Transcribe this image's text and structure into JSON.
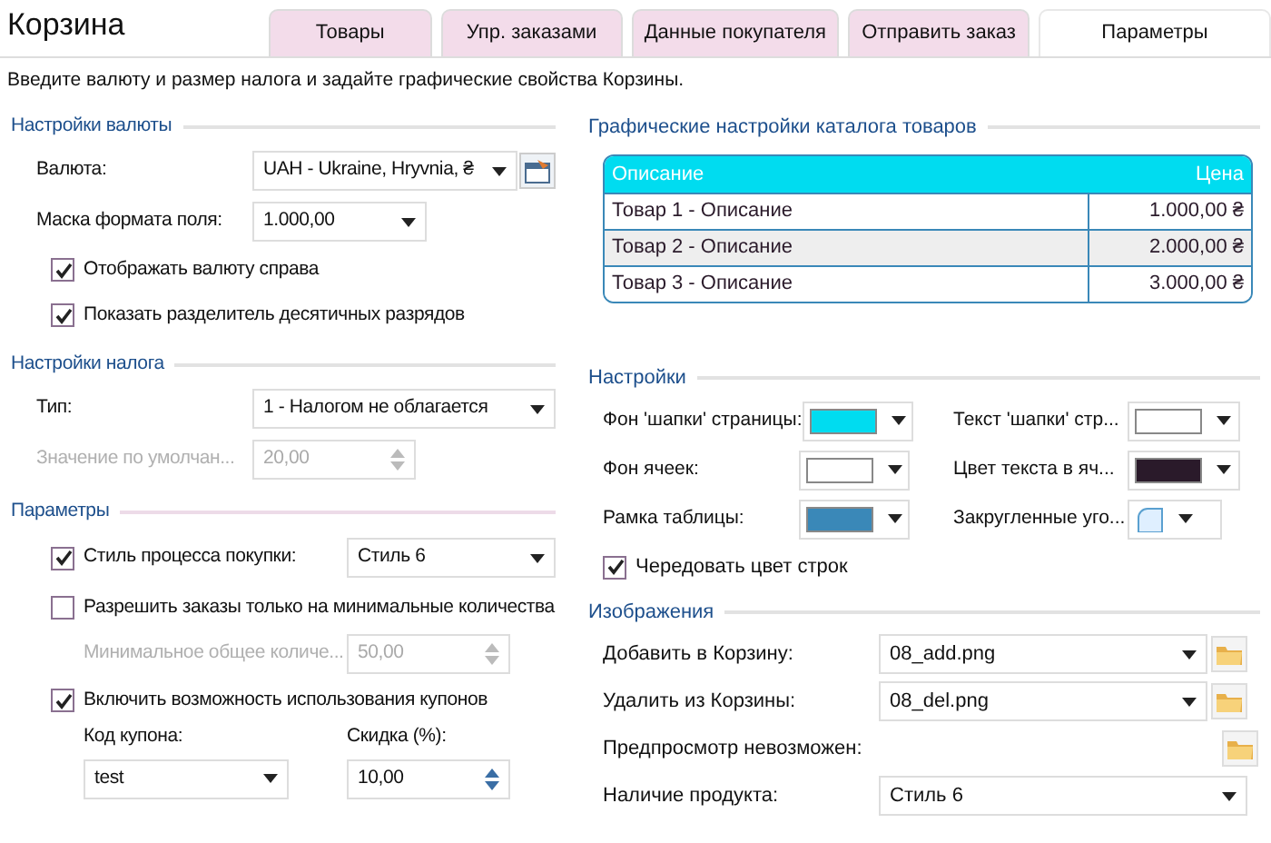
{
  "title": "Корзина",
  "tabs": [
    {
      "label": "Товары",
      "selected": false
    },
    {
      "label": "Упр. заказами",
      "selected": false
    },
    {
      "label": "Данные покупателя",
      "selected": false
    },
    {
      "label": "Отправить заказ",
      "selected": false
    },
    {
      "label": "Параметры",
      "selected": true
    }
  ],
  "description": "Введите валюту и размер налога и задайте графические свойства Корзины.",
  "left_sections": [
    {
      "title": "Настройки валюты",
      "rows": [
        {
          "kind": "select",
          "label": "Валюта:",
          "value": "UAH - Ukraine, Hryvnia, ₴",
          "picker": true
        },
        {
          "kind": "select",
          "label": "Маска формата поля:",
          "value": "1.000,00"
        },
        {
          "kind": "check",
          "label": "Отображать валюту справа",
          "checked": true
        },
        {
          "kind": "check",
          "label": "Показать разделитель десятичных разрядов",
          "checked": true
        }
      ]
    },
    {
      "title": "Настройки налога",
      "rows": [
        {
          "kind": "select",
          "label": "Тип:",
          "value": "1 - Налогом не облагается"
        },
        {
          "kind": "spin",
          "label": "Значение по умолчан...",
          "value": "20,00",
          "disabled": true
        }
      ]
    },
    {
      "title": "Параметры",
      "rows": [
        {
          "kind": "check_select",
          "label": "Стиль процесса покупки:",
          "checked": true,
          "value": "Стиль 6"
        },
        {
          "kind": "check",
          "label": "Разрешить заказы только на минимальные количества",
          "checked": false
        },
        {
          "kind": "sub_spin",
          "label": "Минимальное общее количе...",
          "value": "50,00",
          "disabled": true
        },
        {
          "kind": "check",
          "label": "Включить возможность использования купонов",
          "checked": true
        },
        {
          "kind": "coupon",
          "code_label": "Код купона:",
          "code_value": "test",
          "discount_label": "Скидка (%):",
          "discount_value": "10,00"
        }
      ]
    }
  ],
  "catalog": {
    "title": "Графические настройки каталога товаров",
    "columns": [
      "Описание",
      "Цена"
    ],
    "rows": [
      [
        "Товар 1 - Описание",
        "1.000,00 ₴"
      ],
      [
        "Товар 2 - Описание",
        "2.000,00 ₴"
      ],
      [
        "Товар 3 - Описание",
        "3.000,00 ₴"
      ]
    ]
  },
  "settings": {
    "title": "Настройки",
    "colors": [
      {
        "label": "Фон 'шапки' страницы:",
        "color": "#00dcf0"
      },
      {
        "label": "Текст 'шапки' стр...",
        "color": "#ffffff"
      },
      {
        "label": "Фон ячеек:",
        "color": "#ffffff"
      },
      {
        "label": "Цвет текста в яч...",
        "color": "#2a1a2a"
      },
      {
        "label": "Рамка таблицы:",
        "color": "#3a88b8"
      },
      {
        "label": "Закругленные уго...",
        "rounded": true
      }
    ],
    "alternate": {
      "label": "Чередовать цвет строк",
      "checked": true
    }
  },
  "images": {
    "title": "Изображения",
    "rows": [
      {
        "kind": "file",
        "label": "Добавить в Корзину:",
        "value": "08_add.png"
      },
      {
        "kind": "file",
        "label": "Удалить из Корзины:",
        "value": "08_del.png"
      },
      {
        "kind": "note",
        "label": "Предпросмотр невозможен:"
      },
      {
        "kind": "select",
        "label": "Наличие продукта:",
        "value": "Стиль 6"
      }
    ]
  }
}
